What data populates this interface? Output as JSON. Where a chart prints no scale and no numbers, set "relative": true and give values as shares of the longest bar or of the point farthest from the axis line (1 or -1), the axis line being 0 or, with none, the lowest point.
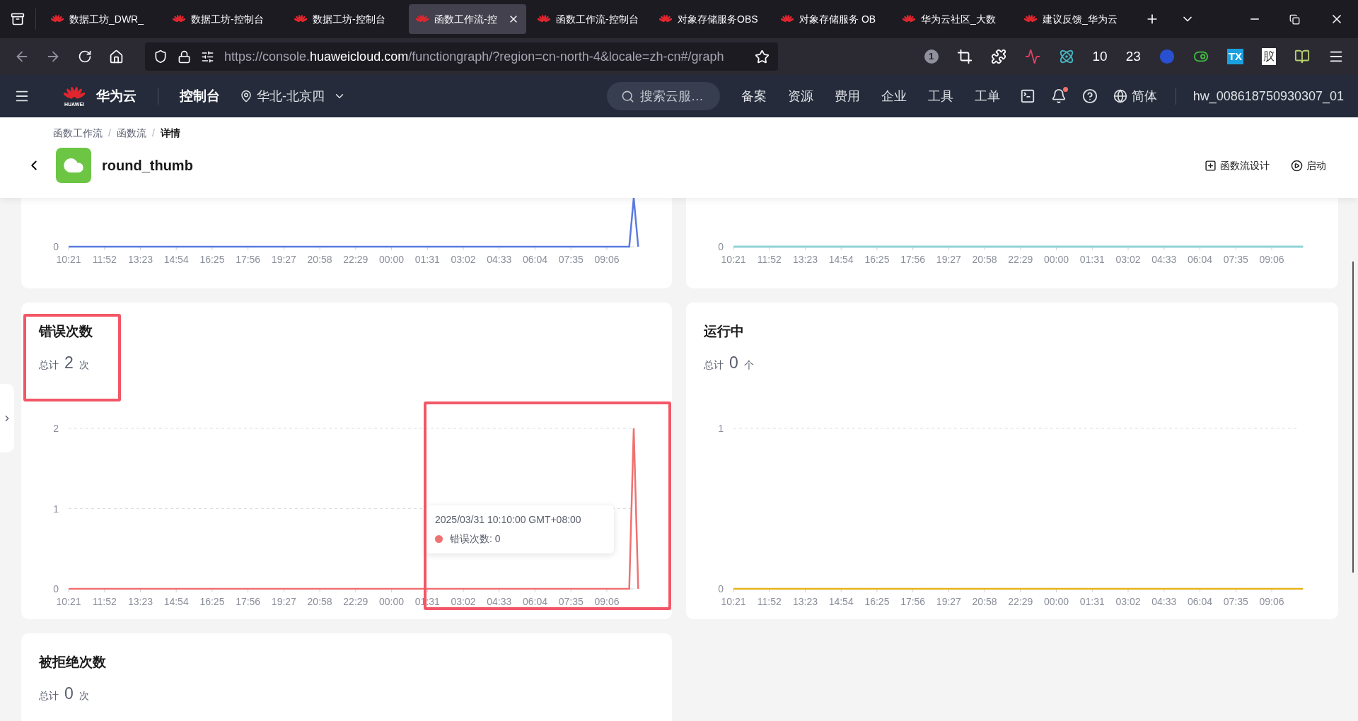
{
  "browser": {
    "tabs": [
      {
        "title": "数据工坊_DWR_",
        "selected": false
      },
      {
        "title": "数据工坊-控制台",
        "selected": false
      },
      {
        "title": "数据工坊-控制台",
        "selected": false
      },
      {
        "title": "函数工作流-控",
        "selected": true
      },
      {
        "title": "函数工作流-控制台",
        "selected": false
      },
      {
        "title": "对象存储服务OBS",
        "selected": false
      },
      {
        "title": "对象存储服务 OB",
        "selected": false
      },
      {
        "title": "华为云社区_大数",
        "selected": false
      },
      {
        "title": "建议反馈_华为云",
        "selected": false
      }
    ],
    "url": "https://console.**huaweicloud.com**/functiongraph/?region=cn-north-4&locale=zh-cn#/graph",
    "extension_texts": [
      "1",
      "10",
      "23",
      "TX",
      "肞"
    ]
  },
  "console": {
    "logo_text": "HUAWEI",
    "brand": "华为云",
    "console": "控制台",
    "region": "华北-北京四",
    "search_placeholder": "搜索云服…",
    "nav": [
      "备案",
      "资源",
      "费用",
      "企业",
      "工具",
      "工单"
    ],
    "unread_notifications": true,
    "language": "简体",
    "user": "hw_008618750930307_01"
  },
  "page": {
    "breadcrumb_separator": "/",
    "breadcrumb": [
      {
        "label": "函数工作流",
        "current": false
      },
      {
        "label": "函数流",
        "current": false
      },
      {
        "label": "详情",
        "current": true
      }
    ],
    "title": "round_thumb",
    "actions": [
      {
        "kind": "design",
        "label": "函数流设计"
      },
      {
        "kind": "start",
        "label": "启动"
      }
    ]
  },
  "cards": [
    {
      "chart_data": {
        "type": "line",
        "relative": true,
        "annotations": [
          "0"
        ],
        "categories": [
          "10:21",
          null,
          null,
          null,
          null,
          null,
          null,
          null,
          "11:52",
          null,
          null,
          null,
          null,
          null,
          null,
          null,
          "13:23",
          null,
          null,
          null,
          null,
          null,
          null,
          null,
          "14:54",
          null,
          null,
          null,
          null,
          null,
          null,
          null,
          "16:25",
          null,
          null,
          null,
          null,
          null,
          null,
          null,
          "17:56",
          null,
          null,
          null,
          null,
          null,
          null,
          null,
          "19:27",
          null,
          null,
          null,
          null,
          null,
          null,
          null,
          "20:58",
          null,
          null,
          null,
          null,
          null,
          null,
          null,
          "22:29",
          null,
          null,
          null,
          null,
          null,
          null,
          null,
          "00:00",
          null,
          null,
          null,
          null,
          null,
          null,
          null,
          "01:31",
          null,
          null,
          null,
          null,
          null,
          null,
          null,
          "03:02",
          null,
          null,
          null,
          null,
          null,
          null,
          null,
          "04:33",
          null,
          null,
          null,
          null,
          null,
          null,
          null,
          "06:04",
          null,
          null,
          null,
          null,
          null,
          null,
          null,
          "07:35",
          null,
          null,
          null,
          null,
          null,
          null,
          null,
          "09:06",
          null,
          null,
          null,
          null,
          null,
          null,
          null
        ],
        "series": [
          {
            "color": "#5b7be0",
            "values": [
              0,
              0,
              0,
              0,
              0,
              0,
              0,
              0,
              0,
              0,
              0,
              0,
              0,
              0,
              0,
              0,
              0,
              0,
              0,
              0,
              0,
              0,
              0,
              0,
              0,
              0,
              0,
              0,
              0,
              0,
              0,
              0,
              0,
              0,
              0,
              0,
              0,
              0,
              0,
              0,
              0,
              0,
              0,
              0,
              0,
              0,
              0,
              0,
              0,
              0,
              0,
              0,
              0,
              0,
              0,
              0,
              0,
              0,
              0,
              0,
              0,
              0,
              0,
              0,
              0,
              0,
              0,
              0,
              0,
              0,
              0,
              0,
              0,
              0,
              0,
              0,
              0,
              0,
              0,
              0,
              0,
              0,
              0,
              0,
              0,
              0,
              0,
              0,
              0,
              0,
              0,
              0,
              0,
              0,
              0,
              0,
              0,
              0,
              0,
              0,
              0,
              0,
              0,
              0,
              0,
              0,
              0,
              0,
              0,
              0,
              0,
              0,
              0,
              0,
              0,
              0,
              0,
              0,
              0,
              0,
              0,
              0,
              0,
              0,
              0,
              0,
              1,
              0
            ]
          }
        ]
      }
    },
    {
      "plot": {
        "zero_label": "0",
        "color": "#8fd3d6",
        "x_labels": [
          "10:21",
          "11:52",
          "13:23",
          "14:54",
          "16:25",
          "17:56",
          "19:27",
          "20:58",
          "22:29",
          "00:00",
          "01:31",
          "03:02",
          "04:33",
          "06:04",
          "07:35",
          "09:06"
        ]
      }
    },
    {
      "title": "错误次数",
      "total_label": "总计",
      "total": "2",
      "unit": "次",
      "highlight_title": true,
      "highlight_chart_end": true,
      "tooltip": {
        "time": "2025/03/31 10:10:00 GMT+08:00",
        "label": "错误次数: 0",
        "color": "#f07171"
      },
      "chart_data": {
        "type": "line",
        "ylim": [
          0,
          2
        ],
        "yticks": [
          0,
          1,
          2
        ],
        "categories": [
          "10:21",
          null,
          null,
          null,
          null,
          null,
          null,
          null,
          "11:52",
          null,
          null,
          null,
          null,
          null,
          null,
          null,
          "13:23",
          null,
          null,
          null,
          null,
          null,
          null,
          null,
          "14:54",
          null,
          null,
          null,
          null,
          null,
          null,
          null,
          "16:25",
          null,
          null,
          null,
          null,
          null,
          null,
          null,
          "17:56",
          null,
          null,
          null,
          null,
          null,
          null,
          null,
          "19:27",
          null,
          null,
          null,
          null,
          null,
          null,
          null,
          "20:58",
          null,
          null,
          null,
          null,
          null,
          null,
          null,
          "22:29",
          null,
          null,
          null,
          null,
          null,
          null,
          null,
          "00:00",
          null,
          null,
          null,
          null,
          null,
          null,
          null,
          "01:31",
          null,
          null,
          null,
          null,
          null,
          null,
          null,
          "03:02",
          null,
          null,
          null,
          null,
          null,
          null,
          null,
          "04:33",
          null,
          null,
          null,
          null,
          null,
          null,
          null,
          "06:04",
          null,
          null,
          null,
          null,
          null,
          null,
          null,
          "07:35",
          null,
          null,
          null,
          null,
          null,
          null,
          null,
          "09:06",
          null,
          null,
          null,
          null,
          null,
          null,
          null
        ],
        "series": [
          {
            "color": "#f07171",
            "values": [
              0,
              0,
              0,
              0,
              0,
              0,
              0,
              0,
              0,
              0,
              0,
              0,
              0,
              0,
              0,
              0,
              0,
              0,
              0,
              0,
              0,
              0,
              0,
              0,
              0,
              0,
              0,
              0,
              0,
              0,
              0,
              0,
              0,
              0,
              0,
              0,
              0,
              0,
              0,
              0,
              0,
              0,
              0,
              0,
              0,
              0,
              0,
              0,
              0,
              0,
              0,
              0,
              0,
              0,
              0,
              0,
              0,
              0,
              0,
              0,
              0,
              0,
              0,
              0,
              0,
              0,
              0,
              0,
              0,
              0,
              0,
              0,
              0,
              0,
              0,
              0,
              0,
              0,
              0,
              0,
              0,
              0,
              0,
              0,
              0,
              0,
              0,
              0,
              0,
              0,
              0,
              0,
              0,
              0,
              0,
              0,
              0,
              0,
              0,
              0,
              0,
              0,
              0,
              0,
              0,
              0,
              0,
              0,
              0,
              0,
              0,
              0,
              0,
              0,
              0,
              0,
              0,
              0,
              0,
              0,
              0,
              0,
              0,
              0,
              0,
              0,
              2,
              0
            ]
          }
        ]
      }
    },
    {
      "title": "运行中",
      "total_label": "总计",
      "total": "0",
      "unit": "个",
      "chart_data": {
        "type": "line",
        "ylim": [
          0,
          1
        ],
        "yticks": [
          0,
          1
        ],
        "categories": [
          "10:21",
          null,
          null,
          null,
          null,
          null,
          null,
          null,
          "11:52",
          null,
          null,
          null,
          null,
          null,
          null,
          null,
          "13:23",
          null,
          null,
          null,
          null,
          null,
          null,
          null,
          "14:54",
          null,
          null,
          null,
          null,
          null,
          null,
          null,
          "16:25",
          null,
          null,
          null,
          null,
          null,
          null,
          null,
          "17:56",
          null,
          null,
          null,
          null,
          null,
          null,
          null,
          "19:27",
          null,
          null,
          null,
          null,
          null,
          null,
          null,
          "20:58",
          null,
          null,
          null,
          null,
          null,
          null,
          null,
          "22:29",
          null,
          null,
          null,
          null,
          null,
          null,
          null,
          "00:00",
          null,
          null,
          null,
          null,
          null,
          null,
          null,
          "01:31",
          null,
          null,
          null,
          null,
          null,
          null,
          null,
          "03:02",
          null,
          null,
          null,
          null,
          null,
          null,
          null,
          "04:33",
          null,
          null,
          null,
          null,
          null,
          null,
          null,
          "06:04",
          null,
          null,
          null,
          null,
          null,
          null,
          null,
          "07:35",
          null,
          null,
          null,
          null,
          null,
          null,
          null,
          "09:06",
          null,
          null,
          null,
          null,
          null,
          null,
          null
        ],
        "series": [
          {
            "color": "#e8b21a",
            "values": [
              0,
              0,
              0,
              0,
              0,
              0,
              0,
              0,
              0,
              0,
              0,
              0,
              0,
              0,
              0,
              0,
              0,
              0,
              0,
              0,
              0,
              0,
              0,
              0,
              0,
              0,
              0,
              0,
              0,
              0,
              0,
              0,
              0,
              0,
              0,
              0,
              0,
              0,
              0,
              0,
              0,
              0,
              0,
              0,
              0,
              0,
              0,
              0,
              0,
              0,
              0,
              0,
              0,
              0,
              0,
              0,
              0,
              0,
              0,
              0,
              0,
              0,
              0,
              0,
              0,
              0,
              0,
              0,
              0,
              0,
              0,
              0,
              0,
              0,
              0,
              0,
              0,
              0,
              0,
              0,
              0,
              0,
              0,
              0,
              0,
              0,
              0,
              0,
              0,
              0,
              0,
              0,
              0,
              0,
              0,
              0,
              0,
              0,
              0,
              0,
              0,
              0,
              0,
              0,
              0,
              0,
              0,
              0,
              0,
              0,
              0,
              0,
              0,
              0,
              0,
              0,
              0,
              0,
              0,
              0,
              0,
              0,
              0,
              0,
              0,
              0,
              0,
              0
            ]
          }
        ]
      }
    },
    {
      "title": "被拒绝次数",
      "total_label": "总计",
      "total": "0",
      "unit": "次"
    }
  ]
}
